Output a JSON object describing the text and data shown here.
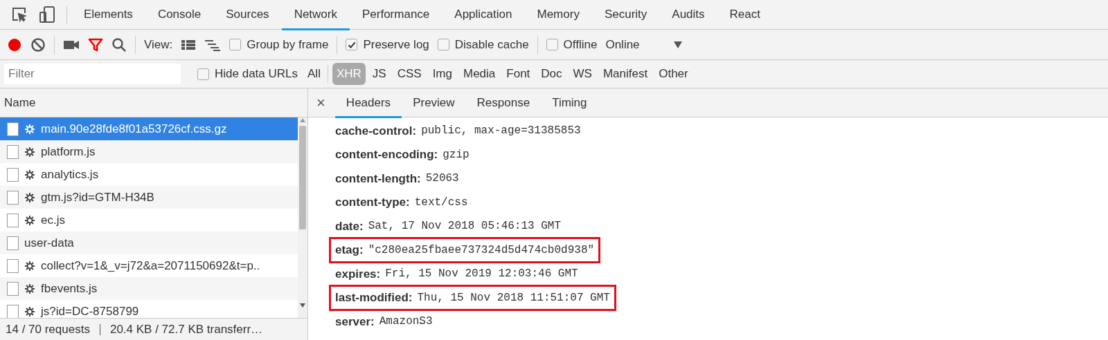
{
  "panel_tabs": [
    {
      "label": "Elements",
      "selected": false
    },
    {
      "label": "Console",
      "selected": false
    },
    {
      "label": "Sources",
      "selected": false
    },
    {
      "label": "Network",
      "selected": true
    },
    {
      "label": "Performance",
      "selected": false
    },
    {
      "label": "Application",
      "selected": false
    },
    {
      "label": "Memory",
      "selected": false
    },
    {
      "label": "Security",
      "selected": false
    },
    {
      "label": "Audits",
      "selected": false
    },
    {
      "label": "React",
      "selected": false
    }
  ],
  "toolbar": {
    "recording": true,
    "filter_on": true,
    "view_label": "View:",
    "options": [
      {
        "label": "Group by frame",
        "checked": false
      },
      {
        "label": "Preserve log",
        "checked": true
      },
      {
        "label": "Disable cache",
        "checked": false
      },
      {
        "label": "Offline",
        "checked": false
      }
    ],
    "throttling": "Online"
  },
  "filter_bar": {
    "placeholder": "Filter",
    "hide_data_urls": {
      "label": "Hide data URLs",
      "checked": false
    },
    "types": [
      {
        "label": "All",
        "selected": false
      },
      {
        "label": "XHR",
        "selected": true
      },
      {
        "label": "JS",
        "selected": false
      },
      {
        "label": "CSS",
        "selected": false
      },
      {
        "label": "Img",
        "selected": false
      },
      {
        "label": "Media",
        "selected": false
      },
      {
        "label": "Font",
        "selected": false
      },
      {
        "label": "Doc",
        "selected": false
      },
      {
        "label": "WS",
        "selected": false
      },
      {
        "label": "Manifest",
        "selected": false
      },
      {
        "label": "Other",
        "selected": false
      }
    ]
  },
  "requests": {
    "column": "Name",
    "rows": [
      {
        "name": "main.90e28fde8f01a53726cf.css.gz",
        "gear": true,
        "selected": true
      },
      {
        "name": "platform.js",
        "gear": true,
        "selected": false
      },
      {
        "name": "analytics.js",
        "gear": true,
        "selected": false
      },
      {
        "name": "gtm.js?id=GTM-H34B",
        "gear": true,
        "selected": false
      },
      {
        "name": "ec.js",
        "gear": true,
        "selected": false
      },
      {
        "name": "user-data",
        "gear": false,
        "selected": false
      },
      {
        "name": "collect?v=1&_v=j72&a=2071150692&t=p..",
        "gear": true,
        "selected": false
      },
      {
        "name": "fbevents.js",
        "gear": true,
        "selected": false
      },
      {
        "name": "js?id=DC-8758799",
        "gear": true,
        "selected": false
      }
    ]
  },
  "status_bar": [
    "14 / 70 requests",
    "20.4 KB / 72.7 KB transferr…"
  ],
  "detail_tabs": [
    {
      "label": "Headers",
      "selected": true
    },
    {
      "label": "Preview",
      "selected": false
    },
    {
      "label": "Response",
      "selected": false
    },
    {
      "label": "Timing",
      "selected": false
    }
  ],
  "close_symbol": "×",
  "headers": [
    {
      "name": "cache-control:",
      "value": "public, max-age=31385853",
      "highlighted": false
    },
    {
      "name": "content-encoding:",
      "value": "gzip",
      "highlighted": false
    },
    {
      "name": "content-length:",
      "value": "52063",
      "highlighted": false
    },
    {
      "name": "content-type:",
      "value": "text/css",
      "highlighted": false
    },
    {
      "name": "date:",
      "value": "Sat, 17 Nov 2018 05:46:13 GMT",
      "highlighted": false
    },
    {
      "name": "etag:",
      "value": "\"c280ea25fbaee737324d5d474cb0d938\"",
      "highlighted": true
    },
    {
      "name": "expires:",
      "value": "Fri, 15 Nov 2019 12:03:46 GMT",
      "highlighted": false
    },
    {
      "name": "last-modified:",
      "value": "Thu, 15 Nov 2018 11:51:07 GMT",
      "highlighted": true
    },
    {
      "name": "server:",
      "value": "AmazonS3",
      "highlighted": false
    }
  ]
}
